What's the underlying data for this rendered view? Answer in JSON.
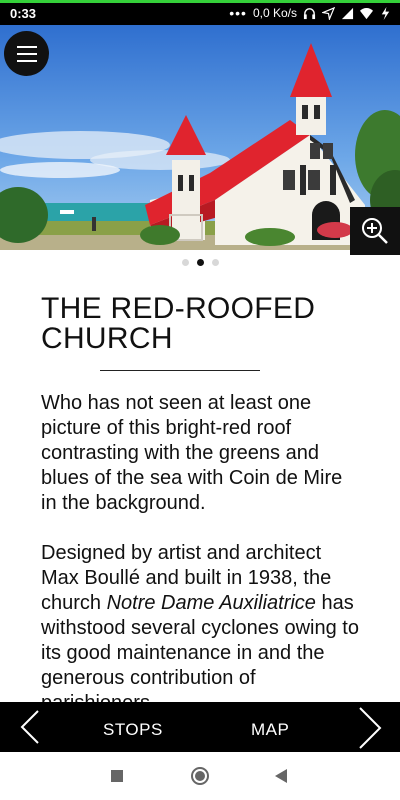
{
  "status_bar": {
    "time": "0:33",
    "notification_dots": "•••",
    "network_speed": "0,0 Ko/s",
    "icons": [
      "headset-icon",
      "location-icon",
      "signal-icon",
      "wifi-icon",
      "charging-icon"
    ],
    "accent_color": "#35d13a"
  },
  "hero": {
    "image_subject": "red-roofed church",
    "menu_icon": "hamburger-icon",
    "zoom_icon": "zoom-in-icon"
  },
  "carousel": {
    "total_pages": 3,
    "active_page": 2
  },
  "article": {
    "title_line1": "THE RED-ROOFED",
    "title_line2": "CHURCH",
    "paragraph1": "Who has not seen at least one picture of this bright-red roof contrasting with the greens and blues of the sea with Coin de Mire in the background.",
    "paragraph2_part1": "Designed by artist and architect Max Boullé and built in 1938, the church ",
    "paragraph2_italic": "Notre Dame Auxiliatrice",
    "paragraph2_part2": " has withstood several cyclones owing to its good maintenance in and the generous contribution of parishioners."
  },
  "bottom_nav": {
    "prev_icon": "chevron-left-icon",
    "stops_label": "STOPS",
    "map_label": "MAP",
    "next_icon": "chevron-right-icon"
  },
  "system_nav": {
    "icons": [
      "recents-icon",
      "home-icon",
      "back-icon"
    ]
  }
}
